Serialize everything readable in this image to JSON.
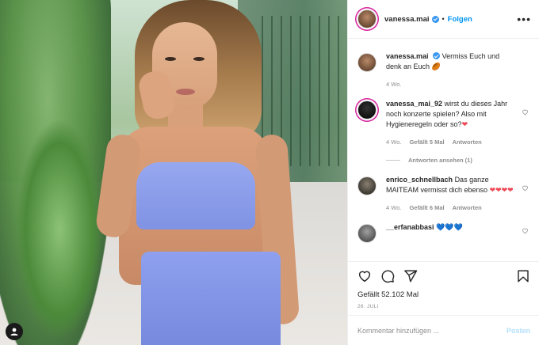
{
  "post": {
    "author": "vanessa.mai",
    "follow_label": "Folgen",
    "more_label": "•••",
    "caption": {
      "username": "vanessa.mai",
      "text": "Vermiss Euch und denk an Euch",
      "emoji": "🏉",
      "time": "4 Wo."
    },
    "comments": [
      {
        "username": "vanessa_mai_92",
        "text": "wirst du dieses Jahr noch konzerte spielen? Also mit Hygieneregeln oder so?",
        "emoji": "❤",
        "time": "4 Wo.",
        "likes": "Gefällt 5 Mal",
        "reply_label": "Antworten",
        "view_replies": "Antworten ansehen (1)"
      },
      {
        "username": "enrico_schnellbach",
        "text": "Das ganze MAITEAM vermisst dich ebenso",
        "emoji": "❤❤❤❤",
        "time": "4 Wo.",
        "likes": "Gefällt 6 Mal",
        "reply_label": "Antworten"
      },
      {
        "username": "__erfanabbasi",
        "text": "",
        "emoji": "💙💙💙"
      }
    ],
    "likes_total": "Gefällt 52.102 Mal",
    "date": "26. JULI",
    "comment_placeholder": "Kommentar hinzufügen ...",
    "post_label": "Posten"
  },
  "icons": {
    "like": "heart-icon",
    "comment": "comment-icon",
    "share": "share-icon",
    "save": "bookmark-icon",
    "verified": "verified-badge-icon",
    "more": "more-options-icon",
    "user_tag": "user-tag-icon"
  },
  "colors": {
    "accent": "#0095f6",
    "verified": "#3897f0",
    "heart": "#ed4956",
    "muted": "#8e8e8e"
  }
}
